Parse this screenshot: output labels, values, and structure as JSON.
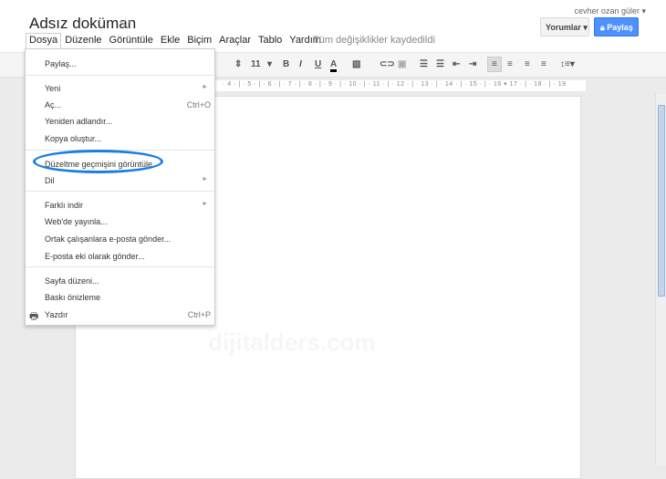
{
  "header": {
    "title": "Adsız doküman",
    "user": "cevher ozan güler ▾",
    "comments_label": "Yorumlar ▾",
    "share_label": "Paylaş",
    "saved_status": "Tüm değişiklikler kaydedildi"
  },
  "menubar": [
    "Dosya",
    "Düzenle",
    "Görüntüle",
    "Ekle",
    "Biçim",
    "Araçlar",
    "Tablo",
    "Yardım"
  ],
  "toolbar": {
    "font_size": "11",
    "bold": "B",
    "italic": "I",
    "underline": "U",
    "text_color": "A"
  },
  "ruler": "· 4 · | · 5 · | · 6 · | · 7 · | · 8 · | · 9 · | · 10 · | · 11 · | · 12 · | · 13 · | · 14 · | · 15 · | · 16 ▾ 17 · | · 18 · | · 19",
  "file_menu": {
    "items": [
      {
        "label": "Paylaş..."
      },
      {
        "label": "Yeni",
        "submenu": true
      },
      {
        "label": "Aç...",
        "shortcut": "Ctrl+O"
      },
      {
        "label": "Yeniden adlandır..."
      },
      {
        "label": "Kopya oluştur..."
      },
      {
        "label": "Düzeltme geçmişini görüntüle",
        "highlighted": true
      },
      {
        "label": "Dil",
        "submenu": true
      },
      {
        "label": "Farklı indir",
        "submenu": true
      },
      {
        "label": "Web'de yayınla..."
      },
      {
        "label": "Ortak çalışanlara e-posta gönder..."
      },
      {
        "label": "E-posta eki olarak gönder..."
      },
      {
        "label": "Sayfa düzeni..."
      },
      {
        "label": "Baskı önizleme"
      },
      {
        "label": "Yazdır",
        "shortcut": "Ctrl+P",
        "icon": "printer-icon"
      }
    ]
  },
  "watermark": "dijitalders.com",
  "colors": {
    "accent": "#4d90fe",
    "highlight_oval": "#1a7fe0"
  }
}
